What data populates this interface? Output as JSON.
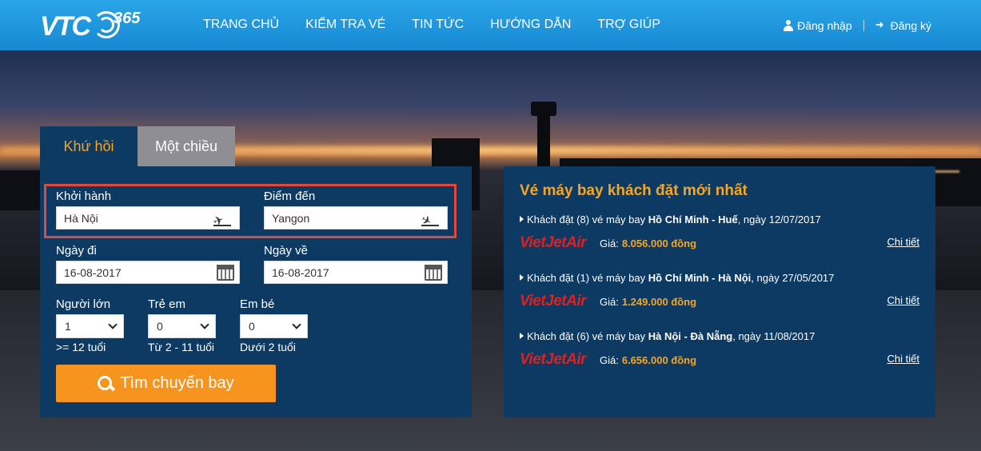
{
  "header": {
    "logo_text": "VTC",
    "logo_suffix": "365",
    "nav": [
      "TRANG CHỦ",
      "KIỂM TRA VÉ",
      "TIN TỨC",
      "HƯỚNG DẪN",
      "TRỢ GIÚP"
    ],
    "login": "Đăng nhập",
    "register": "Đăng ký",
    "colors": {
      "bar": "#1689d3"
    }
  },
  "search": {
    "tabs": [
      "Khứ hồi",
      "Một chiều"
    ],
    "active_tab": 0,
    "from_label": "Khởi hành",
    "from_value": "Hà Nội",
    "to_label": "Điểm đến",
    "to_value": "Yangon",
    "depart_label": "Ngày đi",
    "depart_value": "16-08-2017",
    "return_label": "Ngày về",
    "return_value": "16-08-2017",
    "adults_label": "Người lớn",
    "adults_value": "1",
    "adults_note": ">= 12 tuổi",
    "children_label": "Trẻ em",
    "children_value": "0",
    "children_note": "Từ 2 - 11 tuổi",
    "infants_label": "Em bé",
    "infants_value": "0",
    "infants_note": "Dưới 2 tuổi",
    "button": "Tìm chuyến bay",
    "colors": {
      "panel": "#0d3a63",
      "accent": "#f7941d",
      "highlight": "#e0483e"
    }
  },
  "recent": {
    "title": "Vé máy bay khách đặt mới nhất",
    "price_label": "Giá:",
    "detail_label": "Chi tiết",
    "airline_logo": "VietJetAir",
    "items": [
      {
        "prefix": "Khách đặt (8) vé máy bay ",
        "route": "Hồ Chí Minh - Huế",
        "date": ", ngày 12/07/2017",
        "price": "8.056.000 đồng"
      },
      {
        "prefix": "Khách đặt (1) vé máy bay ",
        "route": "Hồ Chí Minh - Hà Nội",
        "date": ", ngày 27/05/2017",
        "price": "1.249.000 đồng"
      },
      {
        "prefix": "Khách đặt (6) vé máy bay ",
        "route": "Hà Nội - Đà Nẵng",
        "date": ", ngày 11/08/2017",
        "price": "6.656.000 đồng"
      }
    ]
  }
}
